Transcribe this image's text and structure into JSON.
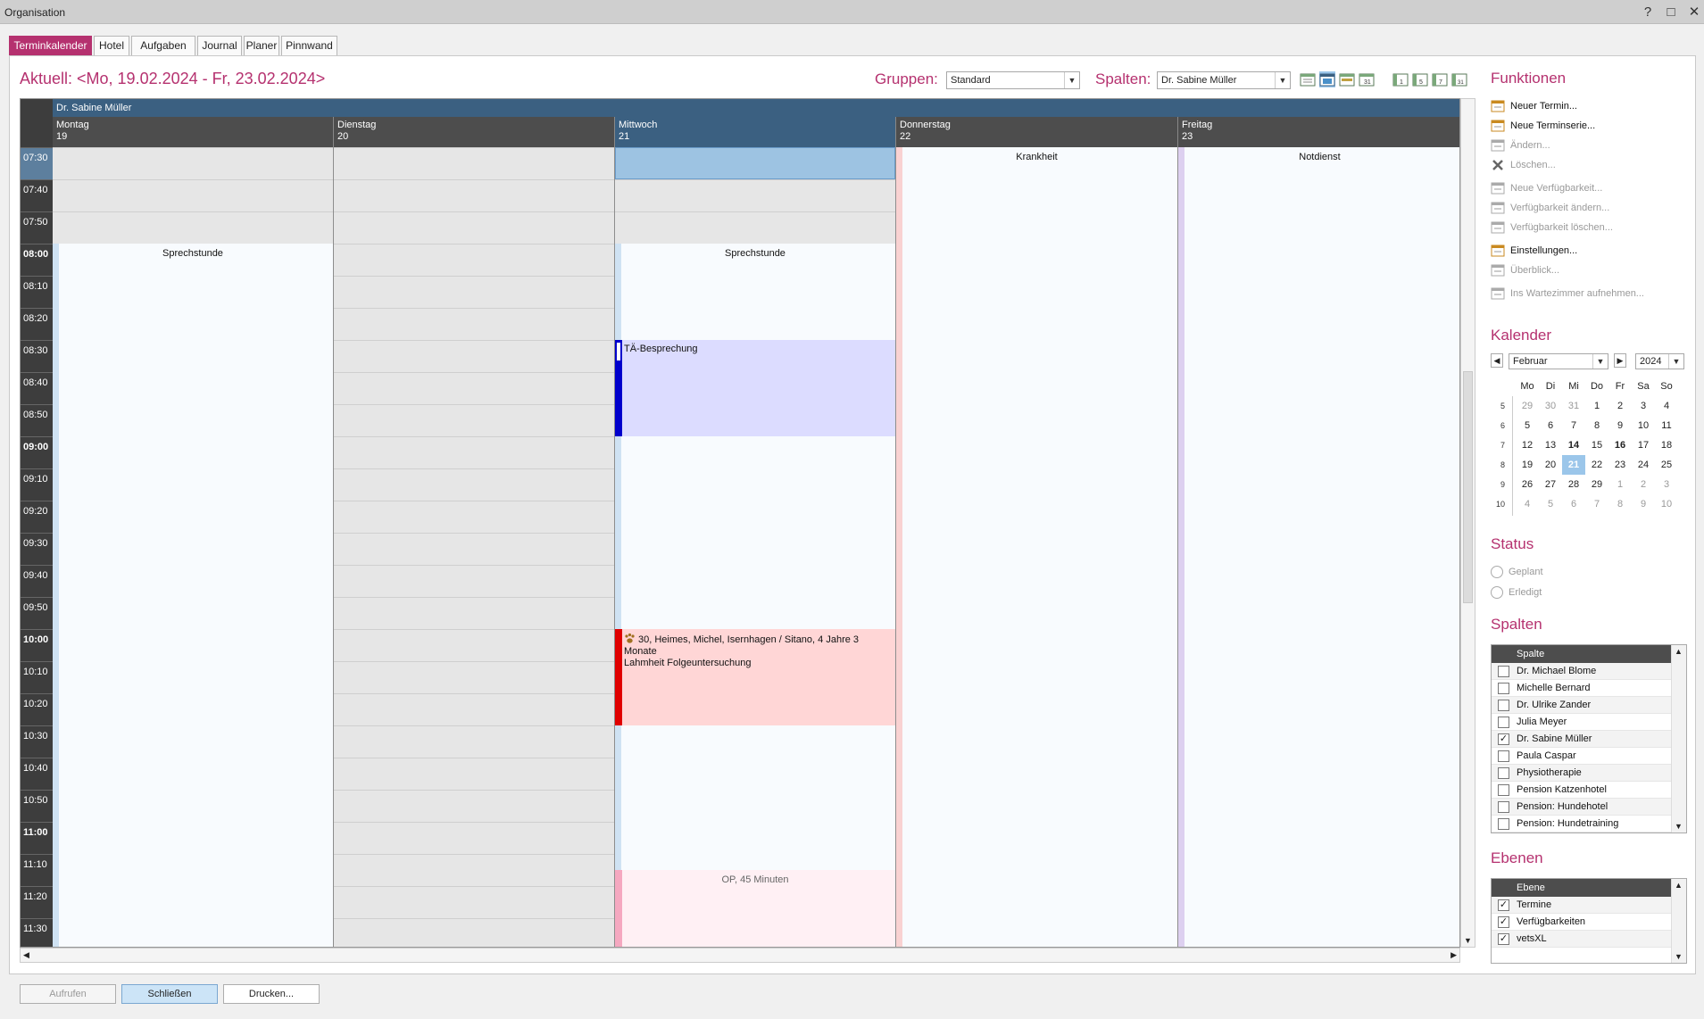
{
  "window": {
    "title": "Organisation",
    "help": "?",
    "maximize": "□",
    "close": "✕"
  },
  "tabs": [
    {
      "label": "Terminkalender",
      "active": true
    },
    {
      "label": "Hotel"
    },
    {
      "label": "Aufgaben"
    },
    {
      "label": "Journal"
    },
    {
      "label": "Planer"
    },
    {
      "label": "Pinnwand"
    }
  ],
  "header": {
    "current": "Aktuell: <Mo, 19.02.2024 - Fr, 23.02.2024>",
    "groups_label": "Gruppen:",
    "groups_value": "Standard",
    "columns_label": "Spalten:",
    "columns_value": "Dr. Sabine Müller"
  },
  "calendar": {
    "resource": "Dr. Sabine Müller",
    "days": [
      {
        "name": "Montag",
        "num": "19"
      },
      {
        "name": "Dienstag",
        "num": "20"
      },
      {
        "name": "Mittwoch",
        "num": "21"
      },
      {
        "name": "Donnerstag",
        "num": "22"
      },
      {
        "name": "Freitag",
        "num": "23"
      }
    ],
    "times": [
      "07:30",
      "07:40",
      "07:50",
      "08:00",
      "08:10",
      "08:20",
      "08:30",
      "08:40",
      "08:50",
      "09:00",
      "09:10",
      "09:20",
      "09:30",
      "09:40",
      "09:50",
      "10:00",
      "10:10",
      "10:20",
      "10:30",
      "10:40",
      "10:50",
      "11:00",
      "11:10",
      "11:20",
      "11:30"
    ],
    "availability": {
      "mon": "Sprechstunde",
      "wed": "Sprechstunde",
      "thu": "Krankheit",
      "fri": "Notdienst",
      "wed_op": "OP, 45 Minuten"
    },
    "events": {
      "meeting": "TÄ-Besprechung",
      "appt_line1": "30, Heimes, Michel, Isernhagen / Sitano, 4 Jahre 3",
      "appt_line2": "Monate",
      "appt_line3": "Lahmheit Folgeuntersuchung"
    }
  },
  "functions": {
    "title": "Funktionen",
    "items": [
      "Neuer Termin...",
      "Neue Terminserie...",
      "Ändern...",
      "Löschen...",
      "Neue Verfügbarkeit...",
      "Verfügbarkeit ändern...",
      "Verfügbarkeit löschen...",
      "Einstellungen...",
      "Überblick...",
      "Ins Wartezimmer aufnehmen..."
    ]
  },
  "mini_calendar": {
    "title": "Kalender",
    "month": "Februar",
    "year": "2024",
    "weekdays": [
      "Mo",
      "Di",
      "Mi",
      "Do",
      "Fr",
      "Sa",
      "So"
    ],
    "weeks": [
      {
        "wk": "5",
        "days": [
          "29",
          "30",
          "31",
          "1",
          "2",
          "3",
          "4"
        ]
      },
      {
        "wk": "6",
        "days": [
          "5",
          "6",
          "7",
          "8",
          "9",
          "10",
          "11"
        ]
      },
      {
        "wk": "7",
        "days": [
          "12",
          "13",
          "14",
          "15",
          "16",
          "17",
          "18"
        ]
      },
      {
        "wk": "8",
        "days": [
          "19",
          "20",
          "21",
          "22",
          "23",
          "24",
          "25"
        ]
      },
      {
        "wk": "9",
        "days": [
          "26",
          "27",
          "28",
          "29",
          "1",
          "2",
          "3"
        ]
      },
      {
        "wk": "10",
        "days": [
          "4",
          "5",
          "6",
          "7",
          "8",
          "9",
          "10"
        ]
      }
    ]
  },
  "status": {
    "title": "Status",
    "options": [
      "Geplant",
      "Erledigt"
    ]
  },
  "columns_list": {
    "title": "Spalten",
    "header": "Spalte",
    "rows": [
      {
        "label": "Dr. Michael Blome",
        "checked": false
      },
      {
        "label": "Michelle Bernard",
        "checked": false
      },
      {
        "label": "Dr. Ulrike Zander",
        "checked": false
      },
      {
        "label": "Julia Meyer",
        "checked": false
      },
      {
        "label": "Dr. Sabine Müller",
        "checked": true
      },
      {
        "label": "Paula Caspar",
        "checked": false
      },
      {
        "label": "Physiotherapie",
        "checked": false
      },
      {
        "label": "Pension Katzenhotel",
        "checked": false
      },
      {
        "label": "Pension: Hundehotel",
        "checked": false
      },
      {
        "label": "Pension: Hundetraining",
        "checked": false
      }
    ]
  },
  "layers": {
    "title": "Ebenen",
    "header": "Ebene",
    "rows": [
      {
        "label": "Termine",
        "checked": true
      },
      {
        "label": "Verfügbarkeiten",
        "checked": true
      },
      {
        "label": "vetsXL",
        "checked": true
      }
    ]
  },
  "footer": {
    "open": "Aufrufen",
    "close": "Schließen",
    "print": "Drucken..."
  },
  "colors": {
    "accent": "#b5316f",
    "selected_header": "#3b6081",
    "meeting": "#0000cc",
    "appointment": "#e00000"
  }
}
